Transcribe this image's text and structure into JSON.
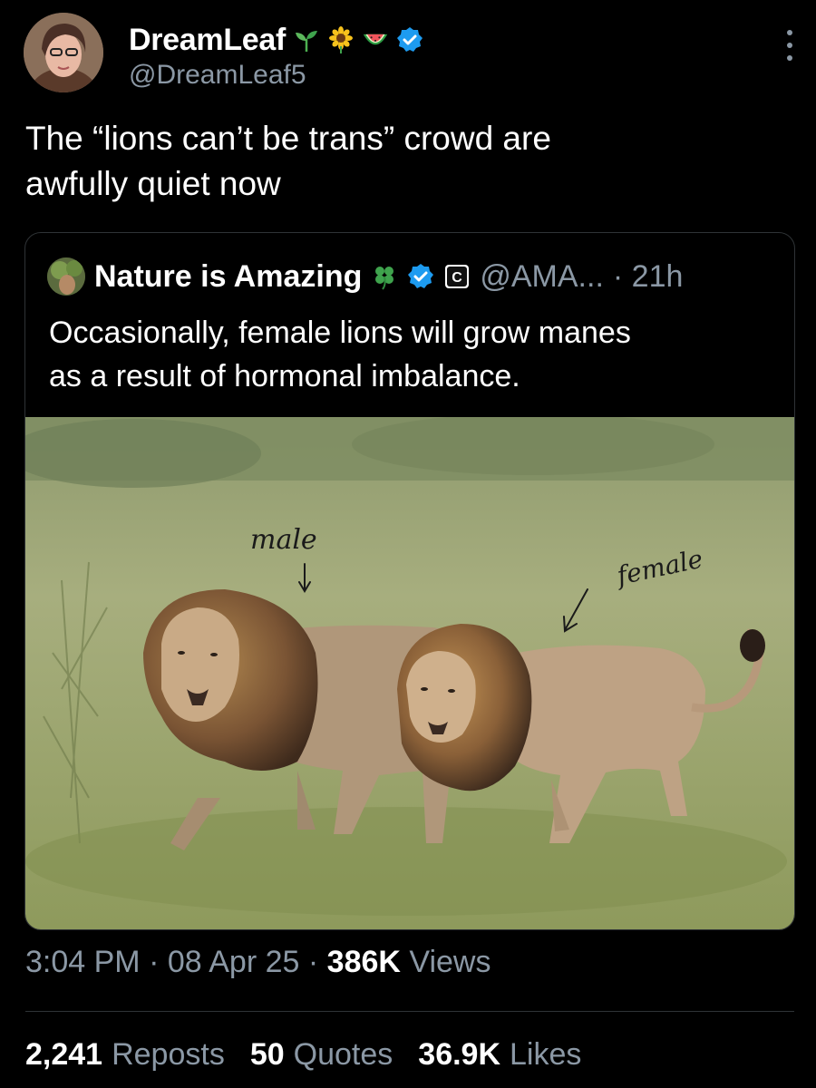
{
  "author": {
    "display_name": "DreamLeaf",
    "handle": "@DreamLeaf5",
    "emoji_icons": [
      "seedling-icon",
      "sunflower-icon",
      "watermelon-icon"
    ],
    "verified_color": "#1d9bf0"
  },
  "tweet": {
    "text_line1": "The “lions can’t be trans” crowd are",
    "text_line2": "awfully quiet now"
  },
  "quoted": {
    "display_name": "Nature is Amazing",
    "name_icon": "four-leaf-clover-icon",
    "handle": "@AMA...",
    "time": "· 21h",
    "text_line1": "Occasionally, female lions will grow manes",
    "text_line2": "as a result of hormonal imbalance.",
    "photo": {
      "annotation_male": "male",
      "annotation_female": "female"
    }
  },
  "meta": {
    "time": "3:04 PM",
    "sep1": "·",
    "date": "08 Apr 25",
    "sep2": "·",
    "views_count": "386K",
    "views_label": "Views"
  },
  "stats": {
    "reposts_count": "2,241",
    "reposts_label": "Reposts",
    "quotes_count": "50",
    "quotes_label": "Quotes",
    "likes_count": "36.9K",
    "likes_label": "Likes"
  },
  "colors": {
    "background": "#000000",
    "text": "#ffffff",
    "muted": "#8b98a5",
    "border": "#2f3336",
    "verified": "#1d9bf0"
  }
}
